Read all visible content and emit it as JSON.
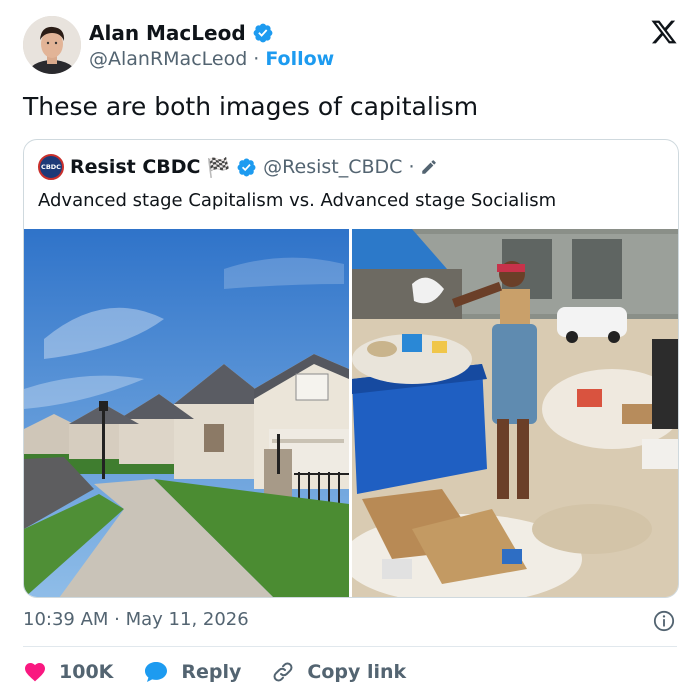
{
  "author": {
    "name": "Alan MacLeod",
    "handle": "@AlanRMacLeod",
    "separator": "·",
    "follow_label": "Follow"
  },
  "tweet": {
    "text": "These are both images of capitalism"
  },
  "quoted": {
    "avatar_text": "CBDC",
    "name": "Resist CBDC",
    "emoji": "🏁",
    "handle": "@Resist_CBDC",
    "separator": "·",
    "text": "Advanced stage Capitalism  vs. Advanced stage Socialism"
  },
  "meta": {
    "timestamp": "10:39 AM · May 11, 2026"
  },
  "actions": {
    "like_count": "100K",
    "reply_label": "Reply",
    "copy_label": "Copy link"
  },
  "colors": {
    "accent": "#1d9bf0",
    "like": "#f91880",
    "text": "#0f1419",
    "muted": "#536471"
  }
}
